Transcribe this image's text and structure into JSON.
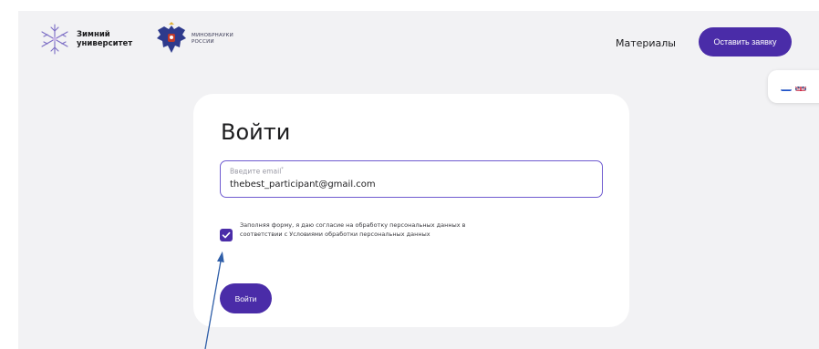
{
  "header": {
    "logo_line1": "Зимний",
    "logo_line2": "университет",
    "ministry_line1": "МИНОБРНАУКИ",
    "ministry_line2": "РОССИИ",
    "nav_materials": "Материалы",
    "apply_button": "Оставить заявку"
  },
  "lang": {
    "ru_icon": "flag-ru-icon",
    "en_icon": "flag-uk-icon"
  },
  "login": {
    "title": "Войти",
    "email_label": "Введите email",
    "email_required_mark": "*",
    "email_value": "thebest_participant@gmail.com",
    "consent_checked": true,
    "consent_text": "Заполняя форму, я даю согласие на обработку персональных данных в соответствии с Условиями обработки персональных данных",
    "submit_button": "Войти"
  },
  "colors": {
    "accent": "#4a2ca8",
    "background": "#f2f2f4",
    "card": "#ffffff",
    "annotation": "#2f5ea8"
  }
}
